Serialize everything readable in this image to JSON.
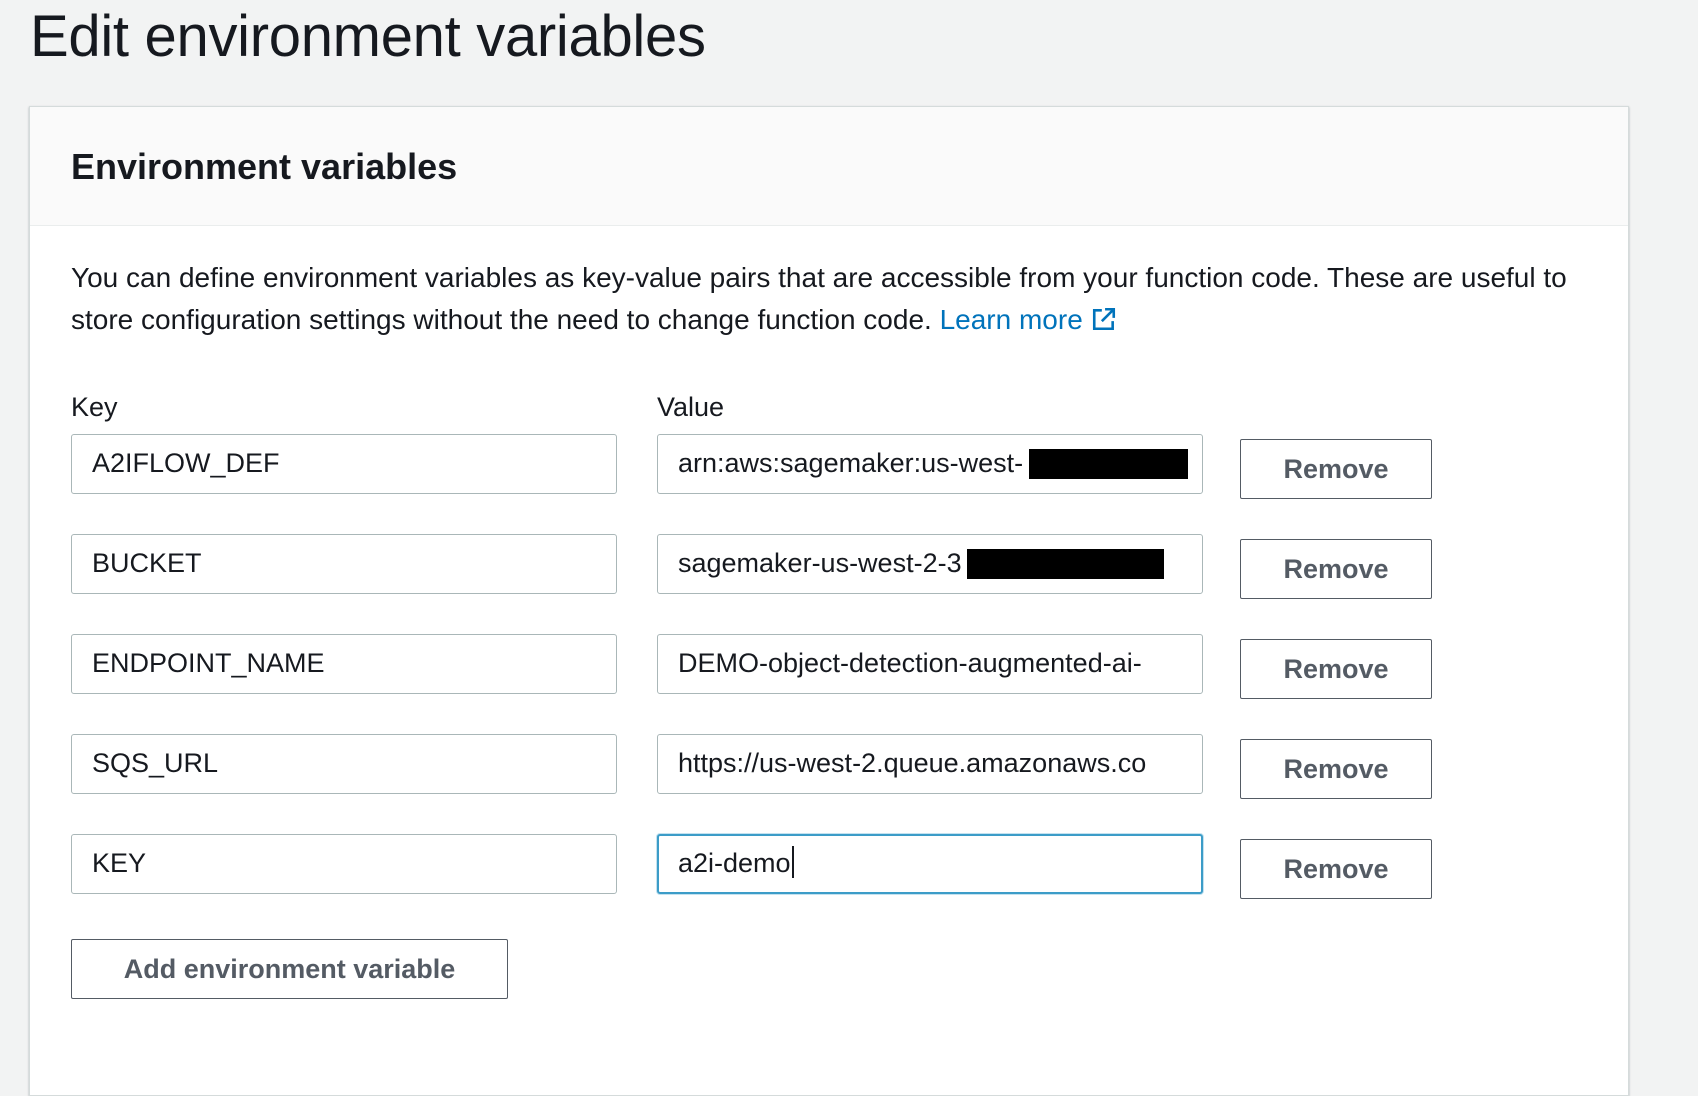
{
  "page": {
    "title": "Edit environment variables"
  },
  "panel": {
    "title": "Environment variables",
    "description": "You can define environment variables as key-value pairs that are accessible from your function code. These are useful to store configuration settings without the need to change function code.",
    "learn_more": "Learn more"
  },
  "columns": {
    "key_label": "Key",
    "value_label": "Value"
  },
  "variables": [
    {
      "key": "A2IFLOW_DEF",
      "value": "arn:aws:sagemaker:us-west-",
      "redacted": true,
      "remove_label": "Remove"
    },
    {
      "key": "BUCKET",
      "value": "sagemaker-us-west-2-3",
      "redacted": true,
      "remove_label": "Remove"
    },
    {
      "key": "ENDPOINT_NAME",
      "value": "DEMO-object-detection-augmented-ai-",
      "redacted": false,
      "remove_label": "Remove"
    },
    {
      "key": "SQS_URL",
      "value": "https://us-west-2.queue.amazonaws.co",
      "redacted": false,
      "remove_label": "Remove"
    },
    {
      "key": "KEY",
      "value": "a2i-demo",
      "redacted": false,
      "focused": true,
      "remove_label": "Remove"
    }
  ],
  "add_button": {
    "label": "Add environment variable"
  },
  "icons": {
    "learn_more": "external-link-icon"
  },
  "colors": {
    "link": "#0073bb",
    "focus_border": "#3c9cc8",
    "button_text": "#545b64"
  }
}
